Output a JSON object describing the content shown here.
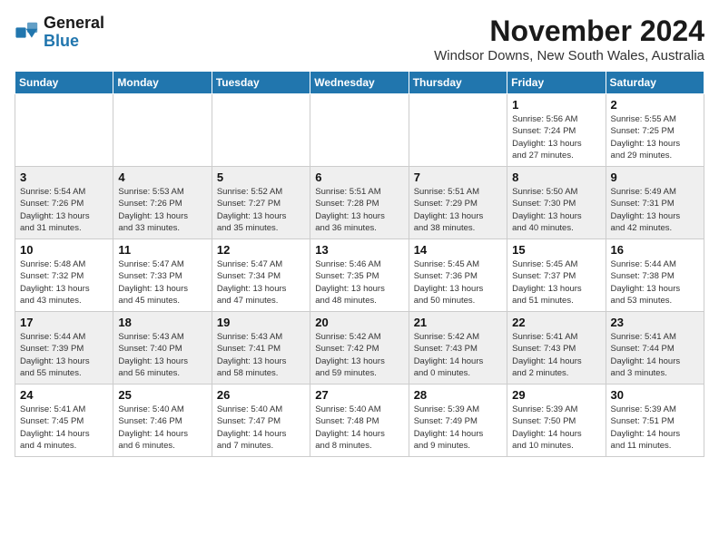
{
  "logo": {
    "general": "General",
    "blue": "Blue"
  },
  "title": "November 2024",
  "subtitle": "Windsor Downs, New South Wales, Australia",
  "weekdays": [
    "Sunday",
    "Monday",
    "Tuesday",
    "Wednesday",
    "Thursday",
    "Friday",
    "Saturday"
  ],
  "weeks": [
    [
      {
        "day": "",
        "info": ""
      },
      {
        "day": "",
        "info": ""
      },
      {
        "day": "",
        "info": ""
      },
      {
        "day": "",
        "info": ""
      },
      {
        "day": "",
        "info": ""
      },
      {
        "day": "1",
        "info": "Sunrise: 5:56 AM\nSunset: 7:24 PM\nDaylight: 13 hours\nand 27 minutes."
      },
      {
        "day": "2",
        "info": "Sunrise: 5:55 AM\nSunset: 7:25 PM\nDaylight: 13 hours\nand 29 minutes."
      }
    ],
    [
      {
        "day": "3",
        "info": "Sunrise: 5:54 AM\nSunset: 7:26 PM\nDaylight: 13 hours\nand 31 minutes."
      },
      {
        "day": "4",
        "info": "Sunrise: 5:53 AM\nSunset: 7:26 PM\nDaylight: 13 hours\nand 33 minutes."
      },
      {
        "day": "5",
        "info": "Sunrise: 5:52 AM\nSunset: 7:27 PM\nDaylight: 13 hours\nand 35 minutes."
      },
      {
        "day": "6",
        "info": "Sunrise: 5:51 AM\nSunset: 7:28 PM\nDaylight: 13 hours\nand 36 minutes."
      },
      {
        "day": "7",
        "info": "Sunrise: 5:51 AM\nSunset: 7:29 PM\nDaylight: 13 hours\nand 38 minutes."
      },
      {
        "day": "8",
        "info": "Sunrise: 5:50 AM\nSunset: 7:30 PM\nDaylight: 13 hours\nand 40 minutes."
      },
      {
        "day": "9",
        "info": "Sunrise: 5:49 AM\nSunset: 7:31 PM\nDaylight: 13 hours\nand 42 minutes."
      }
    ],
    [
      {
        "day": "10",
        "info": "Sunrise: 5:48 AM\nSunset: 7:32 PM\nDaylight: 13 hours\nand 43 minutes."
      },
      {
        "day": "11",
        "info": "Sunrise: 5:47 AM\nSunset: 7:33 PM\nDaylight: 13 hours\nand 45 minutes."
      },
      {
        "day": "12",
        "info": "Sunrise: 5:47 AM\nSunset: 7:34 PM\nDaylight: 13 hours\nand 47 minutes."
      },
      {
        "day": "13",
        "info": "Sunrise: 5:46 AM\nSunset: 7:35 PM\nDaylight: 13 hours\nand 48 minutes."
      },
      {
        "day": "14",
        "info": "Sunrise: 5:45 AM\nSunset: 7:36 PM\nDaylight: 13 hours\nand 50 minutes."
      },
      {
        "day": "15",
        "info": "Sunrise: 5:45 AM\nSunset: 7:37 PM\nDaylight: 13 hours\nand 51 minutes."
      },
      {
        "day": "16",
        "info": "Sunrise: 5:44 AM\nSunset: 7:38 PM\nDaylight: 13 hours\nand 53 minutes."
      }
    ],
    [
      {
        "day": "17",
        "info": "Sunrise: 5:44 AM\nSunset: 7:39 PM\nDaylight: 13 hours\nand 55 minutes."
      },
      {
        "day": "18",
        "info": "Sunrise: 5:43 AM\nSunset: 7:40 PM\nDaylight: 13 hours\nand 56 minutes."
      },
      {
        "day": "19",
        "info": "Sunrise: 5:43 AM\nSunset: 7:41 PM\nDaylight: 13 hours\nand 58 minutes."
      },
      {
        "day": "20",
        "info": "Sunrise: 5:42 AM\nSunset: 7:42 PM\nDaylight: 13 hours\nand 59 minutes."
      },
      {
        "day": "21",
        "info": "Sunrise: 5:42 AM\nSunset: 7:43 PM\nDaylight: 14 hours\nand 0 minutes."
      },
      {
        "day": "22",
        "info": "Sunrise: 5:41 AM\nSunset: 7:43 PM\nDaylight: 14 hours\nand 2 minutes."
      },
      {
        "day": "23",
        "info": "Sunrise: 5:41 AM\nSunset: 7:44 PM\nDaylight: 14 hours\nand 3 minutes."
      }
    ],
    [
      {
        "day": "24",
        "info": "Sunrise: 5:41 AM\nSunset: 7:45 PM\nDaylight: 14 hours\nand 4 minutes."
      },
      {
        "day": "25",
        "info": "Sunrise: 5:40 AM\nSunset: 7:46 PM\nDaylight: 14 hours\nand 6 minutes."
      },
      {
        "day": "26",
        "info": "Sunrise: 5:40 AM\nSunset: 7:47 PM\nDaylight: 14 hours\nand 7 minutes."
      },
      {
        "day": "27",
        "info": "Sunrise: 5:40 AM\nSunset: 7:48 PM\nDaylight: 14 hours\nand 8 minutes."
      },
      {
        "day": "28",
        "info": "Sunrise: 5:39 AM\nSunset: 7:49 PM\nDaylight: 14 hours\nand 9 minutes."
      },
      {
        "day": "29",
        "info": "Sunrise: 5:39 AM\nSunset: 7:50 PM\nDaylight: 14 hours\nand 10 minutes."
      },
      {
        "day": "30",
        "info": "Sunrise: 5:39 AM\nSunset: 7:51 PM\nDaylight: 14 hours\nand 11 minutes."
      }
    ]
  ]
}
